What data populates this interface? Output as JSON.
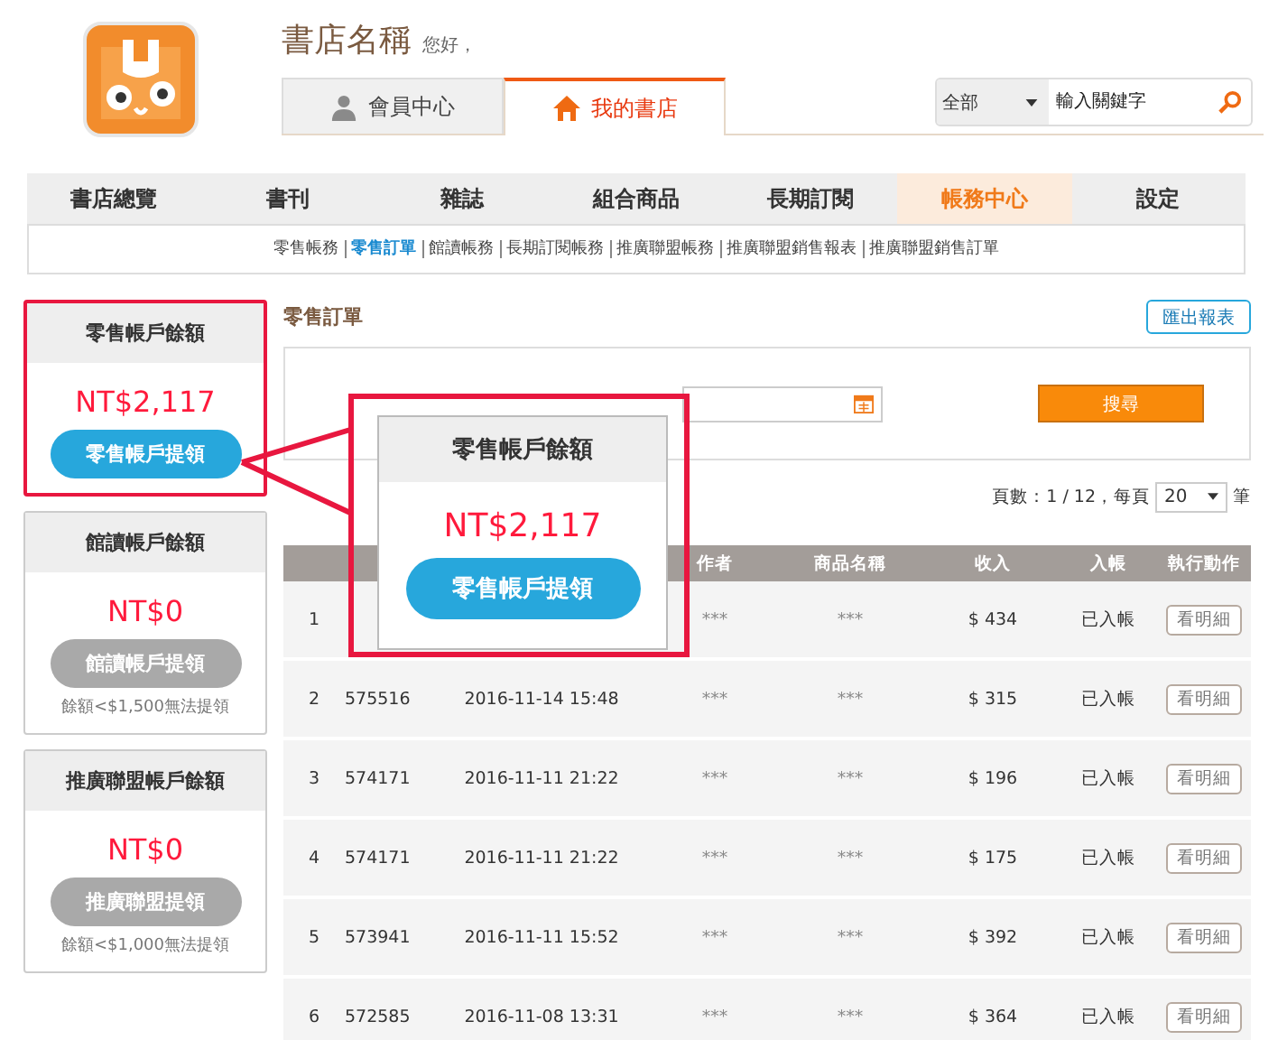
{
  "header": {
    "store_name": "書店名稱",
    "greeting": "您好，"
  },
  "top_tabs": [
    {
      "label": "會員中心",
      "kind": "member",
      "selected": false
    },
    {
      "label": "我的書店",
      "kind": "store",
      "selected": true
    }
  ],
  "search": {
    "category": "全部",
    "placeholder": "輸入關鍵字"
  },
  "nav": [
    {
      "label": "書店總覽",
      "selected": false
    },
    {
      "label": "書刊",
      "selected": false
    },
    {
      "label": "雜誌",
      "selected": false
    },
    {
      "label": "組合商品",
      "selected": false
    },
    {
      "label": "長期訂閱",
      "selected": false
    },
    {
      "label": "帳務中心",
      "selected": true
    },
    {
      "label": "設定",
      "selected": false
    }
  ],
  "subnav": [
    {
      "label": "零售帳務",
      "selected": false
    },
    {
      "label": "零售訂單",
      "selected": true
    },
    {
      "label": "館讀帳務",
      "selected": false
    },
    {
      "label": "長期訂閱帳務",
      "selected": false
    },
    {
      "label": "推廣聯盟帳務",
      "selected": false
    },
    {
      "label": "推廣聯盟銷售報表",
      "selected": false
    },
    {
      "label": "推廣聯盟銷售訂單",
      "selected": false
    }
  ],
  "balance_cards": [
    {
      "title": "零售帳戶餘額",
      "amount": "NT$2,117",
      "button": "零售帳戶提領",
      "disabled": false,
      "highlighted": true
    },
    {
      "title": "館讀帳戶餘額",
      "amount": "NT$0",
      "button": "館讀帳戶提領",
      "disabled": true,
      "highlighted": false,
      "note": "餘額<$1,500無法提領"
    },
    {
      "title": "推廣聯盟帳戶餘額",
      "amount": "NT$0",
      "button": "推廣聯盟提領",
      "disabled": true,
      "highlighted": false,
      "note": "餘額<$1,000無法提領"
    }
  ],
  "callout": {
    "title": "零售帳戶餘額",
    "amount": "NT$2,117",
    "button": "零售帳戶提領"
  },
  "orders": {
    "title": "零售訂單",
    "export_button": "匯出報表",
    "search_button": "搜尋",
    "pagination": {
      "label": "頁數：1 / 12，每頁",
      "per_page": "20",
      "unit": "筆"
    },
    "columns": [
      "作者",
      "商品名稱",
      "收入",
      "入帳",
      "執行動作"
    ],
    "rows": [
      {
        "index": "1",
        "author": "***",
        "product": "***",
        "income": "$ 434",
        "status": "已入帳",
        "action": "看明細"
      },
      {
        "index": "2",
        "order_no": "575516",
        "date": "2016-11-14 15:48",
        "author": "***",
        "product": "***",
        "income": "$ 315",
        "status": "已入帳",
        "action": "看明細"
      },
      {
        "index": "3",
        "order_no": "574171",
        "date": "2016-11-11 21:22",
        "author": "***",
        "product": "***",
        "income": "$ 196",
        "status": "已入帳",
        "action": "看明細"
      },
      {
        "index": "4",
        "order_no": "574171",
        "date": "2016-11-11 21:22",
        "author": "***",
        "product": "***",
        "income": "$ 175",
        "status": "已入帳",
        "action": "看明細"
      },
      {
        "index": "5",
        "order_no": "573941",
        "date": "2016-11-11 15:52",
        "author": "***",
        "product": "***",
        "income": "$ 392",
        "status": "已入帳",
        "action": "看明細"
      },
      {
        "index": "6",
        "order_no": "572585",
        "date": "2016-11-08 13:31",
        "author": "***",
        "product": "***",
        "income": "$ 364",
        "status": "已入帳",
        "action": "看明細"
      }
    ]
  }
}
